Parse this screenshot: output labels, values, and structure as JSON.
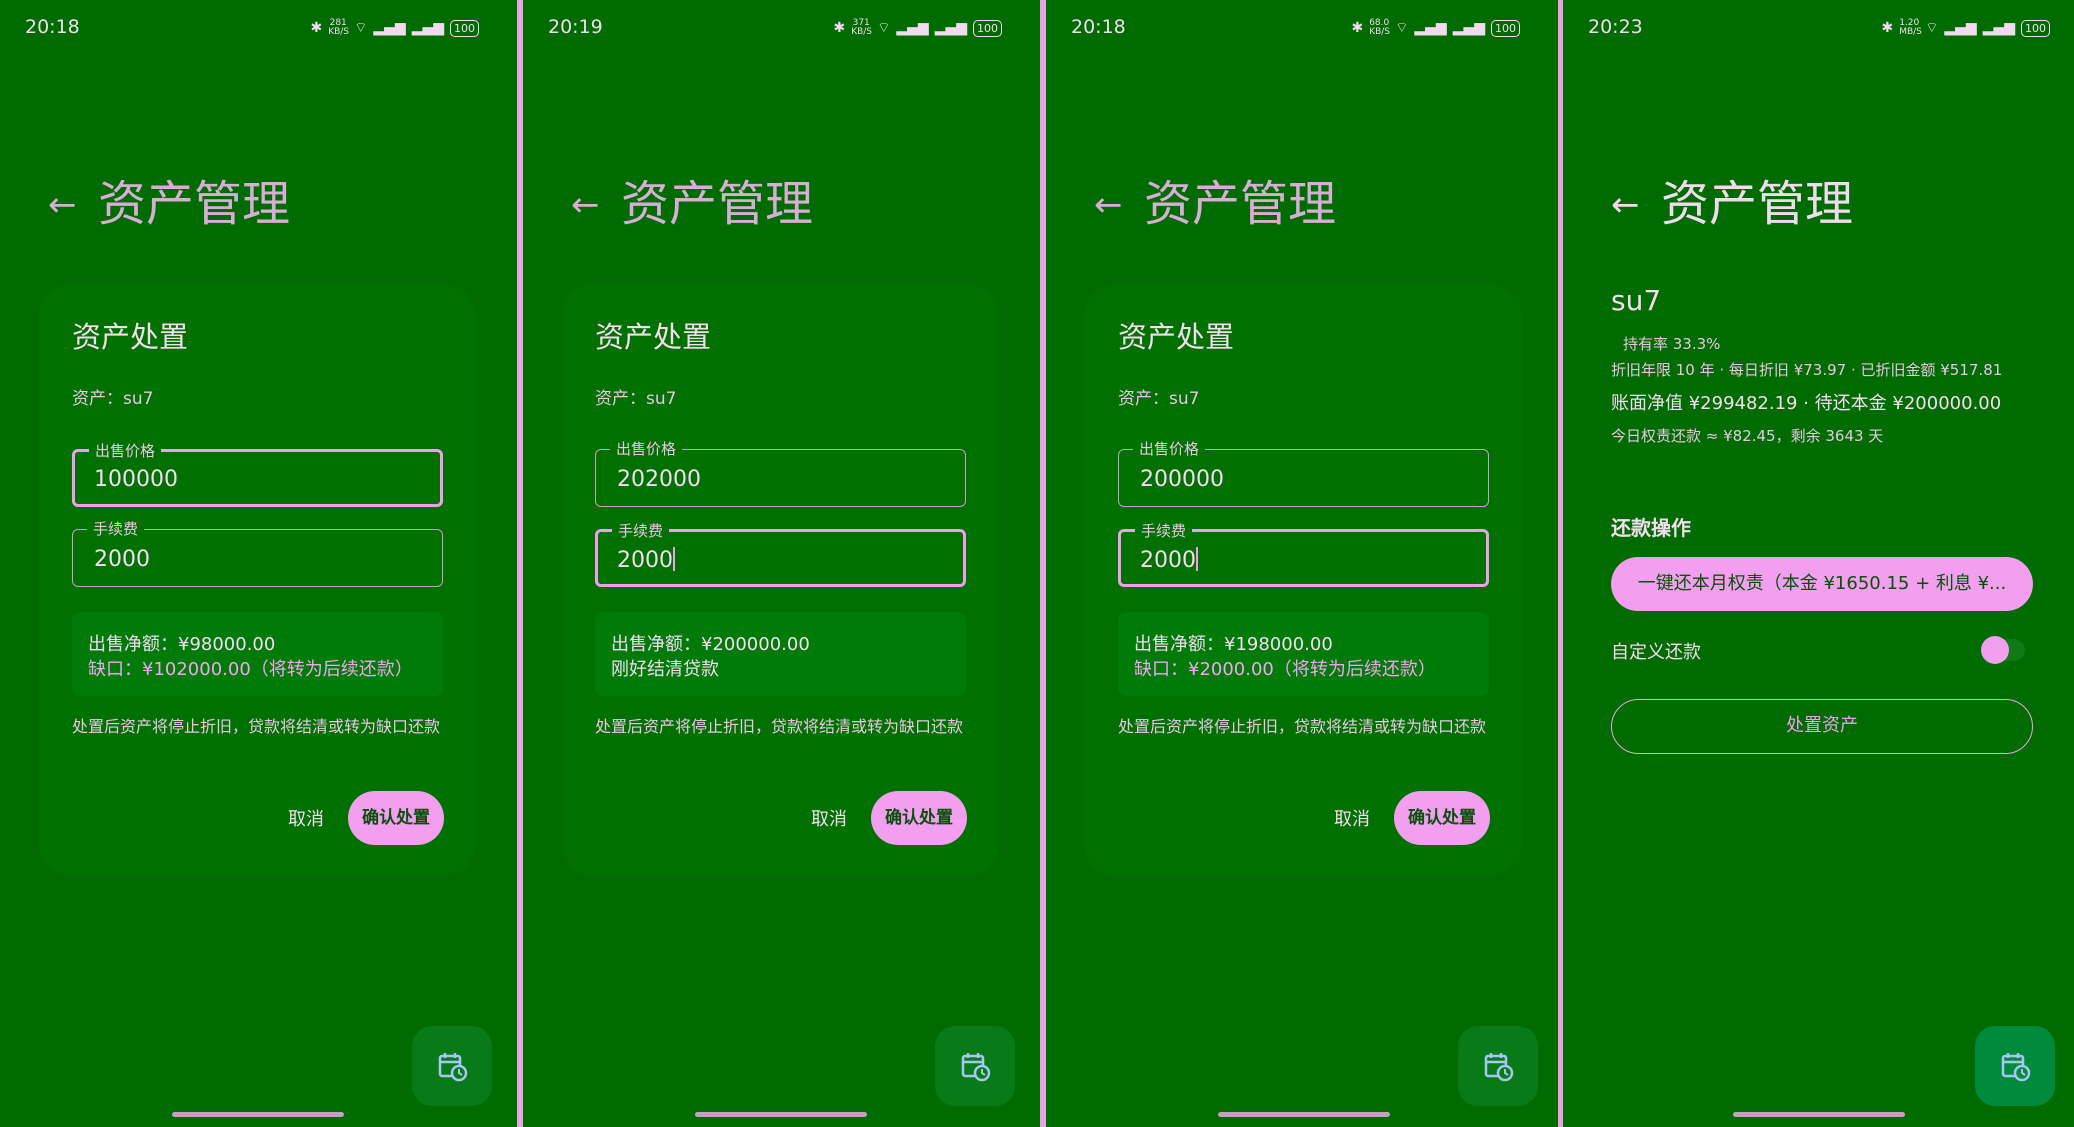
{
  "screens": [
    {
      "time": "20:18",
      "speed": "281",
      "speed_unit": "KB/S",
      "battery": "100",
      "title": "资产管理",
      "dialog": {
        "title": "资产处置",
        "asset": "资产：su7",
        "price_label": "出售价格",
        "price": "100000",
        "fee_label": "手续费",
        "fee": "2000",
        "net": "出售净额：¥98000.00",
        "gap": "缺口：¥102000.00（将转为后续还款）",
        "note": "处置后资产将停止折旧，贷款将结清或转为缺口还款",
        "cancel": "取消",
        "confirm": "确认处置"
      }
    },
    {
      "time": "20:19",
      "speed": "371",
      "speed_unit": "KB/S",
      "battery": "100",
      "title": "资产管理",
      "dialog": {
        "title": "资产处置",
        "asset": "资产：su7",
        "price_label": "出售价格",
        "price": "202000",
        "fee_label": "手续费",
        "fee": "2000",
        "net": "出售净额：¥200000.00",
        "gap": "刚好结清贷款",
        "note": "处置后资产将停止折旧，贷款将结清或转为缺口还款",
        "cancel": "取消",
        "confirm": "确认处置"
      }
    },
    {
      "time": "20:18",
      "speed": "68.0",
      "speed_unit": "KB/S",
      "battery": "100",
      "title": "资产管理",
      "dialog": {
        "title": "资产处置",
        "asset": "资产：su7",
        "price_label": "出售价格",
        "price": "200000",
        "fee_label": "手续费",
        "fee": "2000",
        "net": "出售净额：¥198000.00",
        "gap": "缺口：¥2000.00（将转为后续还款）",
        "note": "处置后资产将停止折旧，贷款将结清或转为缺口还款",
        "cancel": "取消",
        "confirm": "确认处置"
      }
    },
    {
      "time": "20:23",
      "speed": "1.20",
      "speed_unit": "MB/S",
      "battery": "100",
      "title": "资产管理",
      "asset": {
        "name": "su7",
        "rate": "持有率 33.3%",
        "depreciation": "折旧年限 10 年 · 每日折旧 ¥73.97 · 已折旧金额 ¥517.81",
        "book": "账面净值 ¥299482.19 · 待还本金 ¥200000.00",
        "today": "今日权责还款 ≈ ¥82.45，剩余 3643 天"
      },
      "repay": {
        "title": "还款操作",
        "pay_button": "一键还本月权责（本金 ¥1650.15 + 利息 ¥...",
        "custom": "自定义还款",
        "dispose_button": "处置资产"
      }
    }
  ],
  "colors": {
    "background": "#006b00",
    "accent": "#f39ff0",
    "divider": "#e8a4e4"
  }
}
